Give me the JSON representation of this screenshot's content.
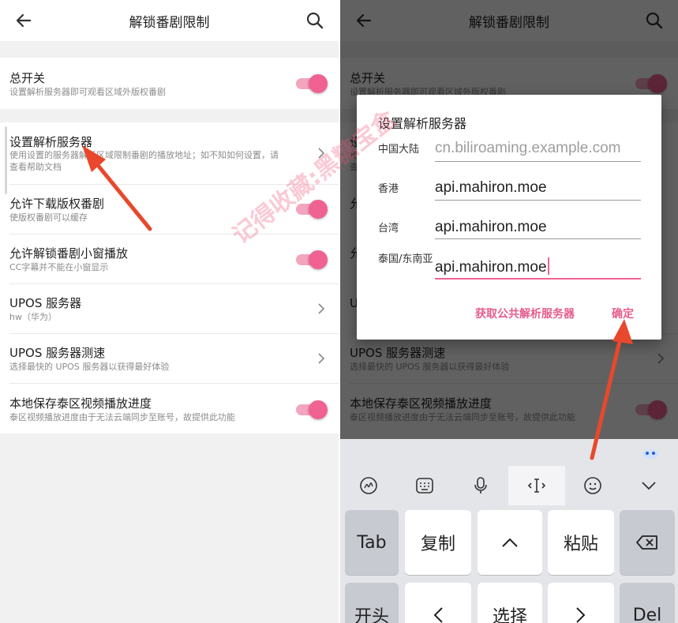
{
  "title": "解锁番剧限制",
  "icons": {
    "back": "arrow-back-icon",
    "search": "search-icon",
    "chevron": "chevron-right-icon"
  },
  "colors": {
    "accent": "#f06292",
    "dialog_button": "#e65c8a",
    "arrow": "#e8482b"
  },
  "settings": {
    "master": {
      "title": "总开关",
      "subtitle": "设置解析服务器即可观看区域外版权番剧",
      "on": true
    },
    "server": {
      "title": "设置解析服务器",
      "subtitle_line1": "使用设置的服务器解析区域限制番剧的播放地址；如不知如何设置，请",
      "subtitle_line2": "查看帮助文档"
    },
    "download": {
      "title": "允许下载版权番剧",
      "subtitle": "使版权番剧可以缓存",
      "on": true
    },
    "pip": {
      "title": "允许解锁番剧小窗播放",
      "subtitle": "CC字幕并不能在小窗显示",
      "on": true
    },
    "upos": {
      "title": "UPOS 服务器",
      "subtitle": "hw（华为）"
    },
    "upos_test": {
      "title": "UPOS 服务器测速",
      "subtitle": "选择最快的 UPOS 服务器以获得最好体验"
    },
    "th_progress": {
      "title": "本地保存泰区视频播放进度",
      "subtitle": "泰区视频播放进度由于无法云端同步至账号，故提供此功能",
      "on": true
    }
  },
  "dialog": {
    "title": "设置解析服务器",
    "fields": [
      {
        "label": "中国大陆",
        "value": "",
        "placeholder": "cn.biliroaming.example.com"
      },
      {
        "label": "香港",
        "value": "api.mahiron.moe"
      },
      {
        "label": "台湾",
        "value": "api.mahiron.moe"
      },
      {
        "label": "泰国/东南亚",
        "value": "api.mahiron.moe"
      }
    ],
    "btn_public": "获取公共解析服务器",
    "btn_ok": "确定"
  },
  "keyboard": {
    "toolbar_icons": [
      "handwriting-input-icon",
      "keyboard-icon",
      "microphone-icon",
      "cursor-move-icon",
      "emoji-icon",
      "collapse-keyboard-icon"
    ],
    "row1": [
      "Tab",
      "复制",
      "^",
      "粘贴",
      "backspace-icon"
    ],
    "row2": [
      "开头",
      "<",
      "选择",
      ">",
      "Del"
    ]
  },
  "watermark": "记得收藏:黑糖宝盒"
}
